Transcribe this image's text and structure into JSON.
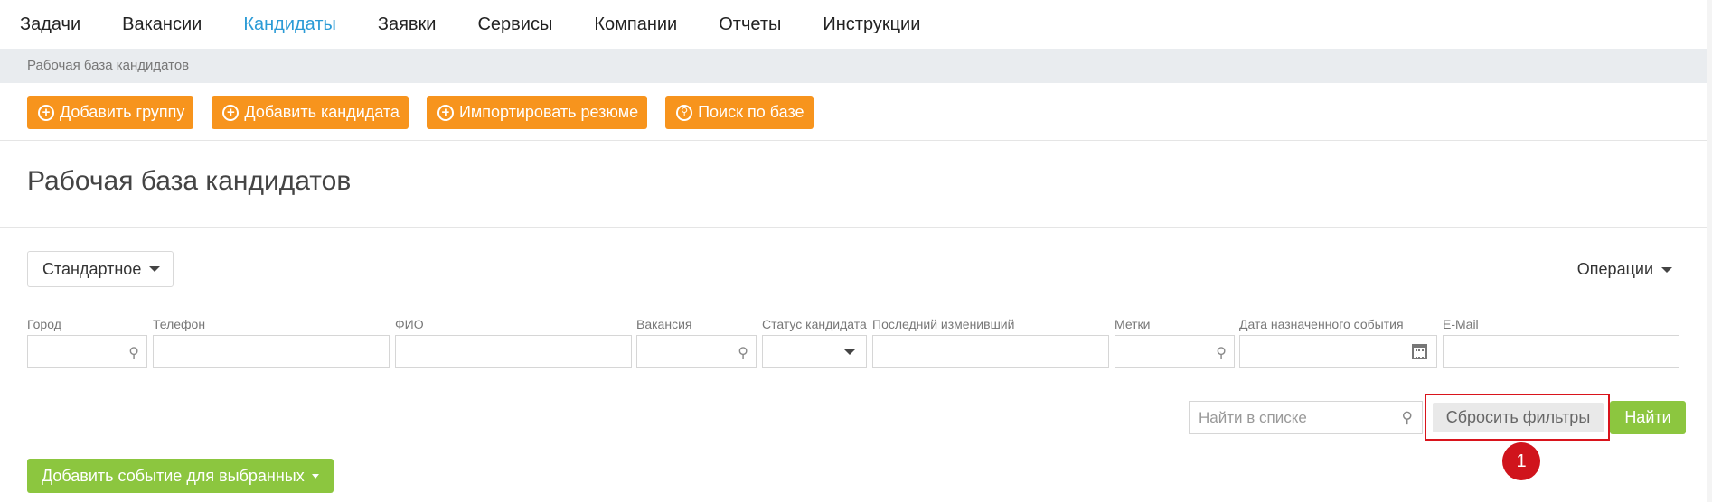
{
  "nav": {
    "items": [
      {
        "label": "Задачи",
        "active": false
      },
      {
        "label": "Вакансии",
        "active": false
      },
      {
        "label": "Кандидаты",
        "active": true
      },
      {
        "label": "Заявки",
        "active": false
      },
      {
        "label": "Сервисы",
        "active": false
      },
      {
        "label": "Компании",
        "active": false
      },
      {
        "label": "Отчеты",
        "active": false
      },
      {
        "label": "Инструкции",
        "active": false
      }
    ]
  },
  "breadcrumb": "Рабочая база кандидатов",
  "actions": {
    "add_group": "Добавить группу",
    "add_candidate": "Добавить кандидата",
    "import_resume": "Импортировать резюме",
    "search_base": "Поиск по базе"
  },
  "page_title": "Рабочая база кандидатов",
  "view_select": "Стандартное",
  "operations": "Операции",
  "filters": {
    "city": "Город",
    "phone": "Телефон",
    "fio": "ФИО",
    "vacancy": "Вакансия",
    "status": "Статус кандидата",
    "last_modified": "Последний изменивший",
    "tags": "Метки",
    "event_date": "Дата назначенного события",
    "email": "E-Mail"
  },
  "list_search_placeholder": "Найти в списке",
  "reset_filters": "Сбросить фильтры",
  "find": "Найти",
  "marker": "1",
  "add_event": "Добавить событие для выбранных",
  "colors": {
    "accent_blue": "#2b9bd6",
    "orange": "#f7941d",
    "green": "#8cc63f",
    "highlight_red": "#d9141c"
  }
}
